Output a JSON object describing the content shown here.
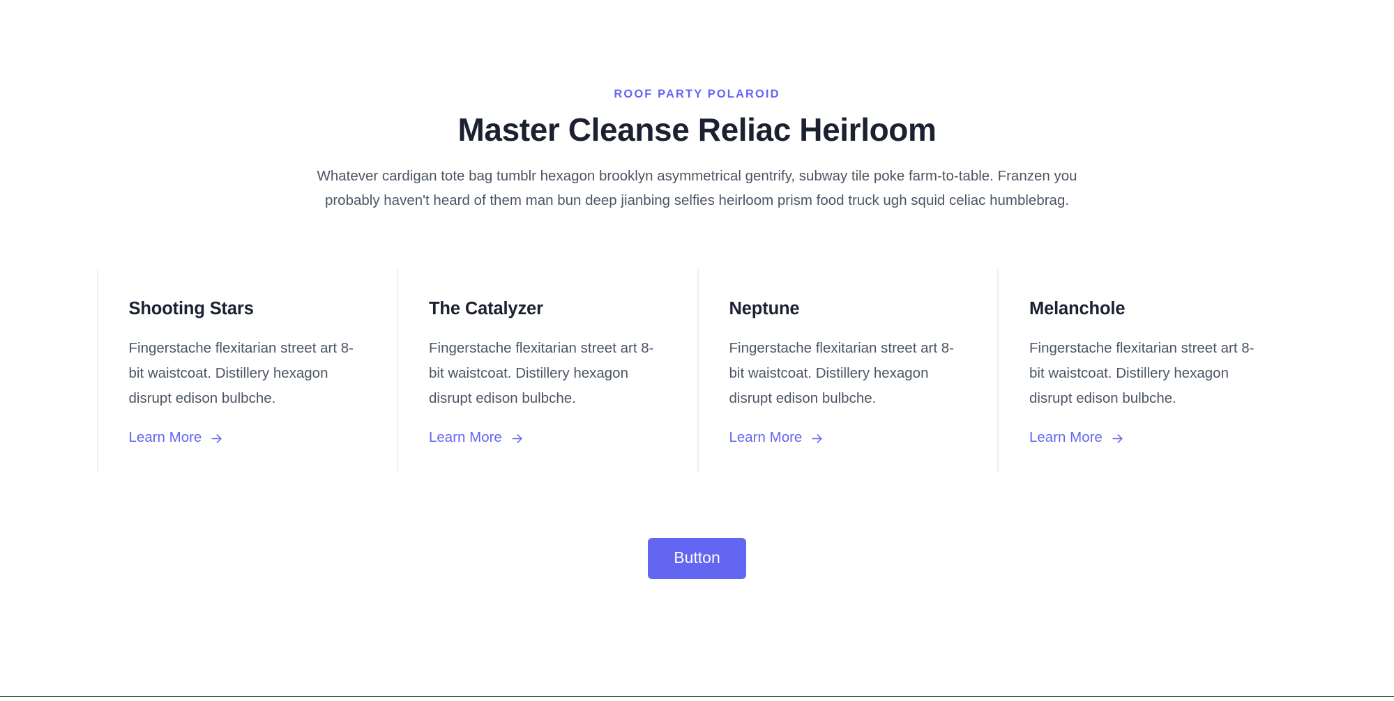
{
  "hero": {
    "eyebrow": "ROOF PARTY POLAROID",
    "title": "Master Cleanse Reliac Heirloom",
    "subtitle": "Whatever cardigan tote bag tumblr hexagon brooklyn asymmetrical gentrify, subway tile poke farm-to-table. Franzen you probably haven't heard of them man bun deep jianbing selfies heirloom prism food truck ugh squid celiac humblebrag."
  },
  "cards": [
    {
      "title": "Shooting Stars",
      "body": "Fingerstache flexitarian street art 8-bit waistcoat. Distillery hexagon disrupt edison bulbche.",
      "link_label": "Learn More",
      "link_icon": "arrow-right-icon"
    },
    {
      "title": "The Catalyzer",
      "body": "Fingerstache flexitarian street art 8-bit waistcoat. Distillery hexagon disrupt edison bulbche.",
      "link_label": "Learn More",
      "link_icon": "arrow-right-icon"
    },
    {
      "title": "Neptune",
      "body": "Fingerstache flexitarian street art 8-bit waistcoat. Distillery hexagon disrupt edison bulbche.",
      "link_label": "Learn More",
      "link_icon": "arrow-right-icon"
    },
    {
      "title": "Melanchole",
      "body": "Fingerstache flexitarian street art 8-bit waistcoat. Distillery hexagon disrupt edison bulbche.",
      "link_label": "Learn More",
      "link_icon": "arrow-right-icon"
    }
  ],
  "cta": {
    "label": "Button"
  },
  "colors": {
    "accent": "#6366f1",
    "heading": "#1b2130",
    "body_text": "#4b5563",
    "card_border": "#eef0f3",
    "page_background": "#ffffff",
    "bottom_rule": "#41554a"
  }
}
